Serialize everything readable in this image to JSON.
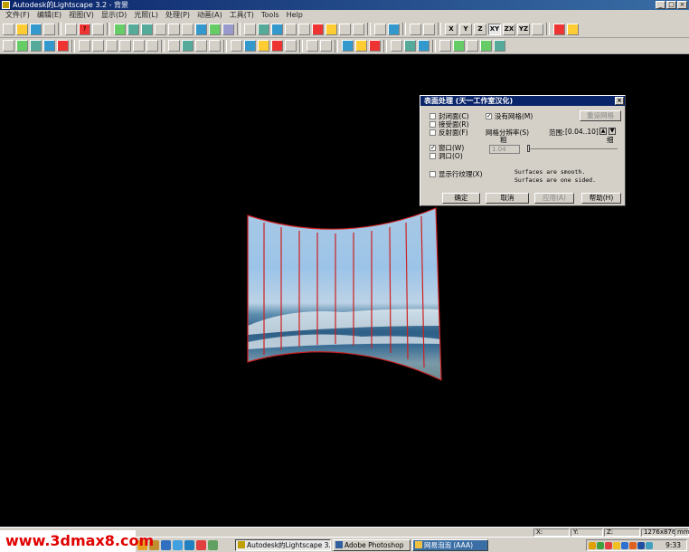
{
  "window": {
    "title": "Autodesk的Lightscape 3.2 - 背景"
  },
  "menu": [
    "文件(F)",
    "编辑(E)",
    "视图(V)",
    "显示(D)",
    "光照(L)",
    "处理(P)",
    "动画(A)",
    "工具(T)",
    "Tools",
    "Help"
  ],
  "toolbar": {
    "view_x": "X",
    "view_y": "Y",
    "view_z": "Z",
    "view_xy": "XY",
    "view_zx": "ZX",
    "view_yz": "YZ"
  },
  "dialog": {
    "title": "表面处理  (天一工作室汉化)",
    "cb_closed": "封闭面(C)",
    "cb_receiver": "接受面(R)",
    "cb_reflector": "反射面(F)",
    "cb_no_mesh": "没有网格(M)",
    "btn_reset_mesh": "重设网格",
    "mesh_resolution_label": "网格分辨率(S)",
    "range_label": "范围:",
    "range_value": "[0.04..10]",
    "coarse": "粗",
    "fine": "细",
    "cb_window": "窗口(W)",
    "cb_opening": "洞口(O)",
    "resolution_value": "1.04",
    "cb_show_texture": "显示行纹理(X)",
    "info_line1": "Surfaces are smooth.",
    "info_line2": "Surfaces are one sided.",
    "btn_ok": "确定",
    "btn_cancel": "取消",
    "btn_apply": "应用(A)",
    "btn_help": "帮助(H)"
  },
  "status": {
    "x": "X:",
    "y": "Y:",
    "z": "Z:",
    "size": "1276x876",
    "unit": "mm"
  },
  "taskbar": {
    "logo": "www.3dmax8.com",
    "task1": "Autodesk的Lightscape 3....",
    "task2": "Adobe Photoshop",
    "task3": "网易泡泡 (AAA)",
    "clock": "9:33"
  },
  "colors": {
    "title_blue": "#0a246a",
    "accent_red": "#cc2020",
    "panel_gray": "#d4d0c8"
  },
  "viewport_object": {
    "type": "curved-panel",
    "segments": 10
  }
}
